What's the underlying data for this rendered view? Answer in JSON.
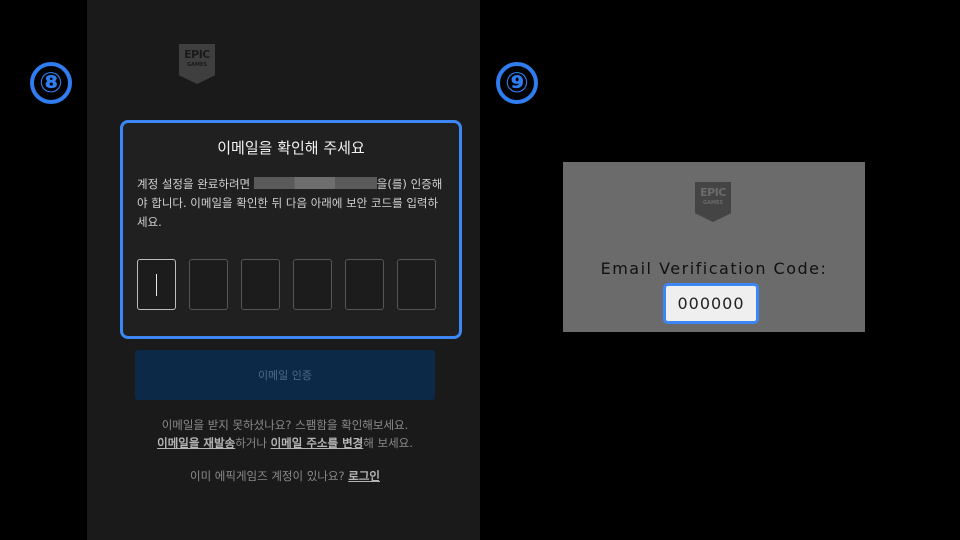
{
  "steps": {
    "left": "⑧",
    "right": "⑨"
  },
  "logo": {
    "line1": "EPIC",
    "line2": "GAMES"
  },
  "verify": {
    "title": "이메일을 확인해 주세요",
    "desc_before": "계정 설정을 완료하려면",
    "desc_after": "을(를) 인증해야 합니다. 이메일을 확인한 뒤 다음 아래에 보안 코드를 입력하세요.",
    "code_cells": [
      "",
      "",
      "",
      "",
      "",
      ""
    ],
    "button_label": "이메일 인증"
  },
  "help": {
    "line1": "이메일을 받지 못하셨나요? 스팸함을 확인해보세요.",
    "resend_link": "이메일을 재발송",
    "mid": "하거나 ",
    "change_link": "이메일 주소를 변경",
    "end": "해 보세요.",
    "login_prompt": "이미 에픽게임즈 계정이 있나요? ",
    "login_link": "로그인"
  },
  "right": {
    "label": "Email Verification Code:",
    "code_value": "000000"
  },
  "colors": {
    "accent": "#3d86f5",
    "button_bg": "#0c2a47"
  }
}
